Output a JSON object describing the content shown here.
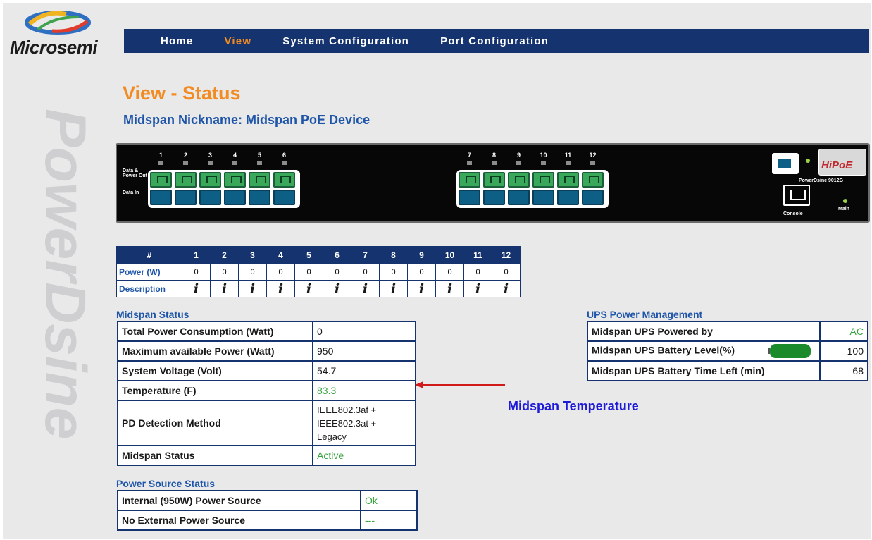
{
  "brand": {
    "logo_text": "Microsemi",
    "watermark": "PowerDsine",
    "colors": {
      "nav": "#15336e",
      "accent": "#f28c22",
      "link": "#1f55a8",
      "ok": "#3aa441"
    }
  },
  "nav": {
    "items": [
      {
        "label": "Home",
        "active": false
      },
      {
        "label": "View",
        "active": true
      },
      {
        "label": "System Configuration",
        "active": false
      },
      {
        "label": "Port Configuration",
        "active": false
      }
    ]
  },
  "page": {
    "title": "View - Status",
    "nickname": "Midspan Nickname: Midspan PoE Device"
  },
  "device": {
    "label_data_power": "Data & Power Out",
    "label_data_in": "Data In",
    "ports_left": [
      "1",
      "2",
      "3",
      "4",
      "5",
      "6"
    ],
    "ports_right": [
      "7",
      "8",
      "9",
      "10",
      "11",
      "12"
    ],
    "model": "PowerDsine 9012G",
    "console_label": "Console",
    "main_label": "Main",
    "brand_badge": "HiPoE"
  },
  "port_table": {
    "header_label": "#",
    "ports": [
      "1",
      "2",
      "3",
      "4",
      "5",
      "6",
      "7",
      "8",
      "9",
      "10",
      "11",
      "12"
    ],
    "power_label": "Power (W)",
    "power": [
      "0",
      "0",
      "0",
      "0",
      "0",
      "0",
      "0",
      "0",
      "0",
      "0",
      "0",
      "0"
    ],
    "description_label": "Description",
    "info_glyph": "i"
  },
  "midspan_status": {
    "title": "Midspan Status",
    "rows": [
      {
        "key": "Total Power Consumption (Watt)",
        "value": "0"
      },
      {
        "key": "Maximum available Power (Watt)",
        "value": "950"
      },
      {
        "key": "System Voltage (Volt)",
        "value": "54.7"
      },
      {
        "key": "Temperature (F)",
        "value": "83.3"
      },
      {
        "key": "PD Detection Method",
        "value_lines": [
          "IEEE802.3af +",
          "IEEE802.3at +",
          "Legacy"
        ]
      },
      {
        "key": "Midspan Status",
        "value": "Active"
      }
    ]
  },
  "ups": {
    "title": "UPS Power Management",
    "powered_by_label": "Midspan UPS Powered by",
    "powered_by": "AC",
    "battery_level_label": "Midspan UPS Battery Level(%)",
    "battery_level": "100",
    "battery_fill": 1.0,
    "time_left_label": "Midspan UPS Battery Time Left (min)",
    "time_left": "68"
  },
  "power_source": {
    "title": "Power Source Status",
    "rows": [
      {
        "key": "Internal (950W) Power Source",
        "value": "Ok"
      },
      {
        "key": "No External Power Source",
        "value": "---"
      }
    ]
  },
  "annotation": {
    "text": "Midspan Temperature",
    "arrow_color": "#d11a1a"
  }
}
